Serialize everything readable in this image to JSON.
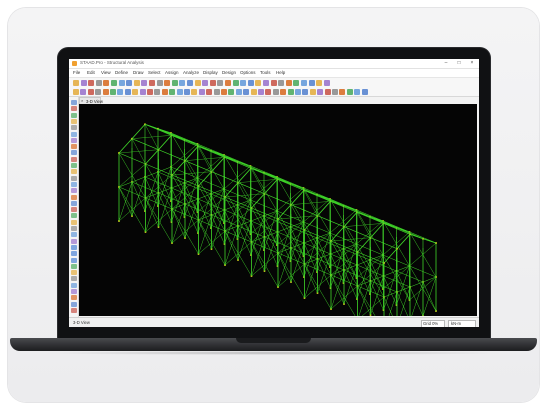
{
  "app": {
    "title": "STAAD.Pro - Structural Analysis"
  },
  "menu": {
    "items": [
      "File",
      "Edit",
      "View",
      "Define",
      "Draw",
      "Select",
      "Assign",
      "Analyze",
      "Display",
      "Design",
      "Options",
      "Tools",
      "Help"
    ]
  },
  "view_tab": {
    "label": "3-D View"
  },
  "status": {
    "left": "3-D View",
    "zoom": "Grid 0%",
    "units": "kN-m"
  },
  "colors": {
    "structure": "#3fd629",
    "node": "#c9c91a",
    "viewport_bg": "#050505",
    "accent_blue": "#2f6fd0"
  }
}
